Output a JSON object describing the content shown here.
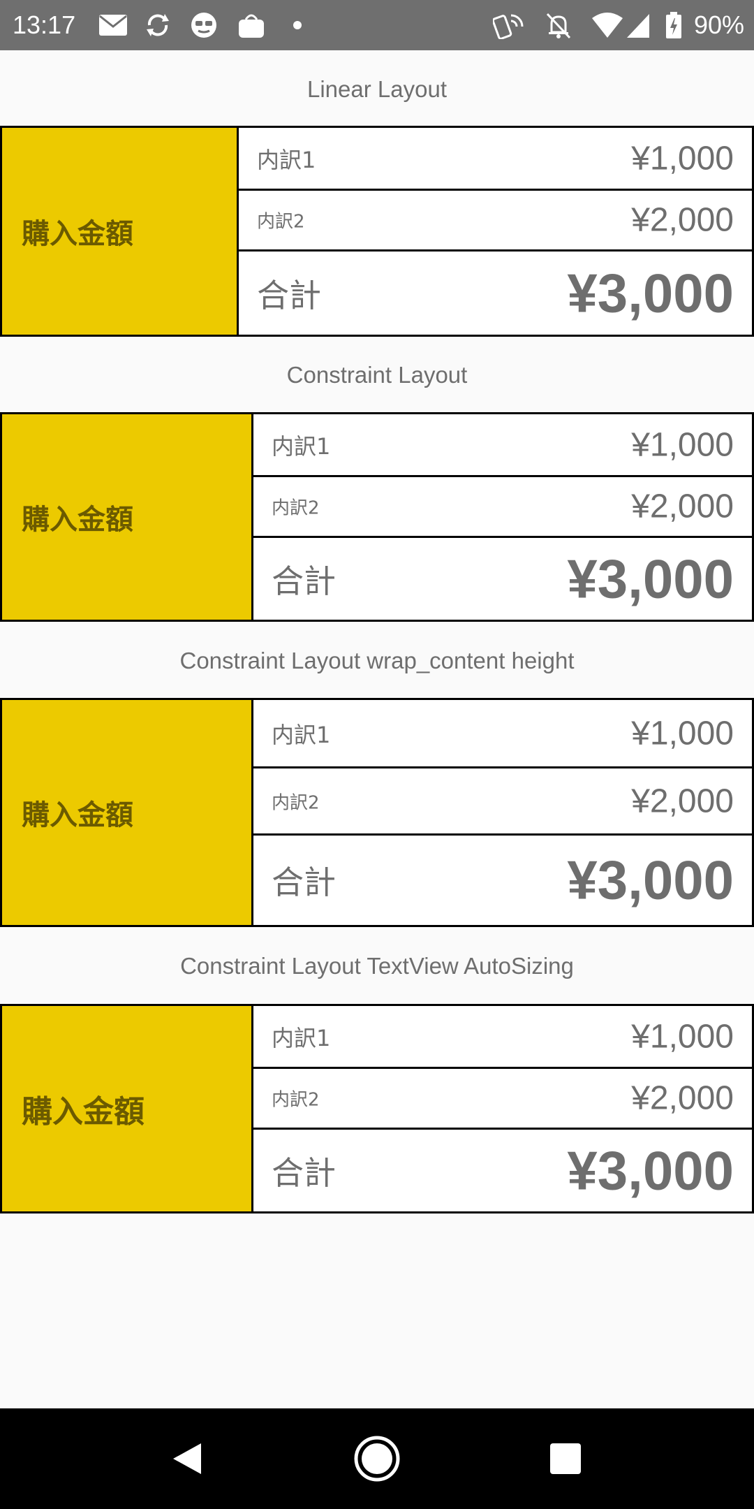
{
  "status_bar": {
    "time": "13:17",
    "battery": "90%",
    "icons": [
      "mail-icon",
      "sync-icon",
      "face-icon",
      "market-icon",
      "dot-icon",
      "nfc-icon",
      "silent-bell-icon",
      "wifi-icon",
      "signal-icon",
      "battery-icon"
    ]
  },
  "sections": [
    {
      "title": "Linear Layout",
      "label": "購入金額",
      "rows": [
        {
          "key": "内訳1",
          "value": "¥1,000"
        },
        {
          "key": "内訳2",
          "value": "¥2,000"
        },
        {
          "key": "合計",
          "value": "¥3,000"
        }
      ]
    },
    {
      "title": "Constraint Layout",
      "label": "購入金額",
      "rows": [
        {
          "key": "内訳1",
          "value": "¥1,000"
        },
        {
          "key": "内訳2",
          "value": "¥2,000"
        },
        {
          "key": "合計",
          "value": "¥3,000"
        }
      ]
    },
    {
      "title": "Constraint Layout wrap_content height",
      "label": "購入金額",
      "rows": [
        {
          "key": "内訳1",
          "value": "¥1,000"
        },
        {
          "key": "内訳2",
          "value": "¥2,000"
        },
        {
          "key": "合計",
          "value": "¥3,000"
        }
      ]
    },
    {
      "title": "Constraint Layout TextView AutoSizing",
      "label": "購入金額",
      "rows": [
        {
          "key": "内訳1",
          "value": "¥1,000"
        },
        {
          "key": "内訳2",
          "value": "¥2,000"
        },
        {
          "key": "合計",
          "value": "¥3,000"
        }
      ]
    }
  ],
  "nav_bar": {
    "icons": [
      "back-icon",
      "home-icon",
      "recents-icon"
    ]
  }
}
